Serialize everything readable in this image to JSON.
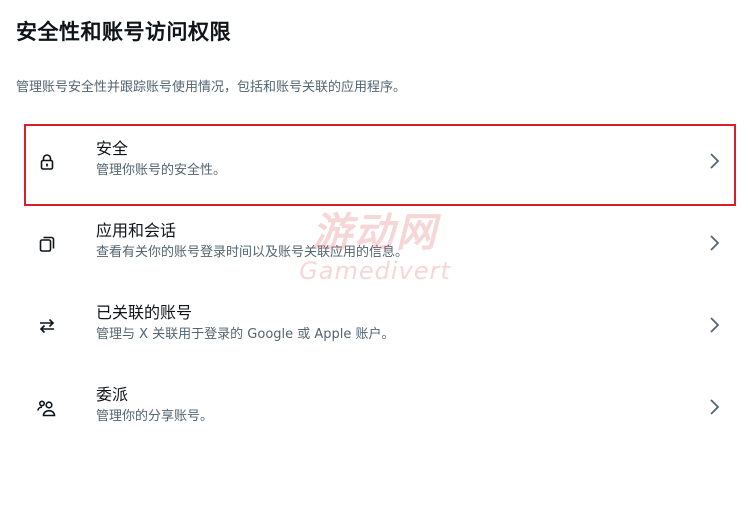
{
  "page": {
    "title": "安全性和账号访问权限",
    "description": "管理账号安全性并跟踪账号使用情况，包括和账号关联的应用程序。"
  },
  "menu": {
    "items": [
      {
        "icon": "lock-icon",
        "title": "安全",
        "description": "管理你账号的安全性。",
        "selected": true
      },
      {
        "icon": "copy-icon",
        "title": "应用和会话",
        "description": "查看有关你的账号登录时间以及账号关联应用的信息。"
      },
      {
        "icon": "swap-arrows-icon",
        "title": "已关联的账号",
        "description": "管理与 X 关联用于登录的 Google 或 Apple 账户。"
      },
      {
        "icon": "people-icon",
        "title": "委派",
        "description": "管理你的分享账号。"
      }
    ],
    "chevron_icon": "chevron-right-icon"
  },
  "watermark": {
    "cn_text": "游动网",
    "en_text": "Gamedivert"
  },
  "colors": {
    "text_primary": "#0f1419",
    "text_secondary": "#536471",
    "highlight_border": "#d6202b"
  }
}
